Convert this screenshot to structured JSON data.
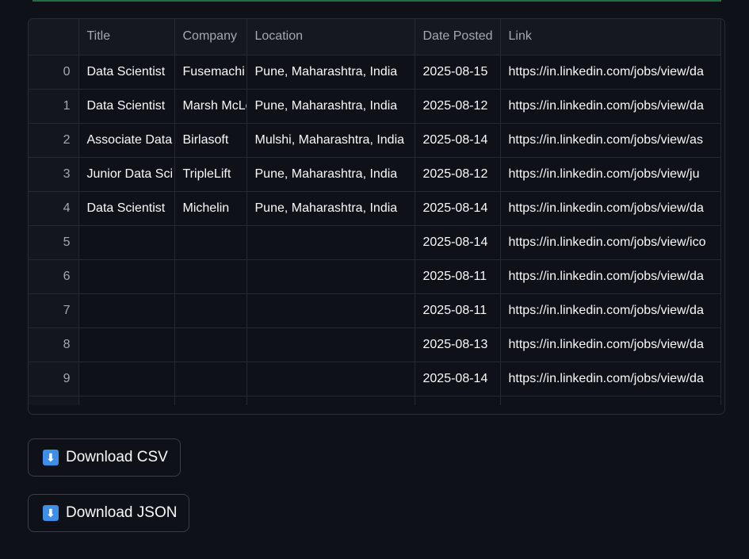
{
  "table": {
    "columns": [
      "",
      "Title",
      "Company",
      "Location",
      "Date Posted",
      "Link"
    ],
    "rows": [
      {
        "index": "0",
        "title": "Data Scientist",
        "company": "Fusemachi",
        "location": "Pune, Maharashtra, India",
        "date": "2025-08-15",
        "link": "https://in.linkedin.com/jobs/view/da"
      },
      {
        "index": "1",
        "title": "Data Scientist",
        "company": "Marsh McLe",
        "location": "Pune, Maharashtra, India",
        "date": "2025-08-12",
        "link": "https://in.linkedin.com/jobs/view/da"
      },
      {
        "index": "2",
        "title": "Associate Data",
        "company": "Birlasoft",
        "location": "Mulshi, Maharashtra, India",
        "date": "2025-08-14",
        "link": "https://in.linkedin.com/jobs/view/as"
      },
      {
        "index": "3",
        "title": "Junior Data Sci",
        "company": "TripleLift",
        "location": "Pune, Maharashtra, India",
        "date": "2025-08-12",
        "link": "https://in.linkedin.com/jobs/view/ju"
      },
      {
        "index": "4",
        "title": "Data Scientist",
        "company": "Michelin",
        "location": "Pune, Maharashtra, India",
        "date": "2025-08-14",
        "link": "https://in.linkedin.com/jobs/view/da"
      },
      {
        "index": "5",
        "title": "",
        "company": "",
        "location": "",
        "date": "2025-08-14",
        "link": "https://in.linkedin.com/jobs/view/ico"
      },
      {
        "index": "6",
        "title": "",
        "company": "",
        "location": "",
        "date": "2025-08-11",
        "link": "https://in.linkedin.com/jobs/view/da"
      },
      {
        "index": "7",
        "title": "",
        "company": "",
        "location": "",
        "date": "2025-08-11",
        "link": "https://in.linkedin.com/jobs/view/da"
      },
      {
        "index": "8",
        "title": "",
        "company": "",
        "location": "",
        "date": "2025-08-13",
        "link": "https://in.linkedin.com/jobs/view/da"
      },
      {
        "index": "9",
        "title": "",
        "company": "",
        "location": "",
        "date": "2025-08-14",
        "link": "https://in.linkedin.com/jobs/view/da"
      }
    ]
  },
  "buttons": {
    "csv_label": "Download CSV",
    "json_label": "Download JSON",
    "icon": "⬇"
  },
  "colors": {
    "background": "#0e1117",
    "accent_line": "#1f6f3f",
    "download_icon": "#3d8fe8"
  }
}
